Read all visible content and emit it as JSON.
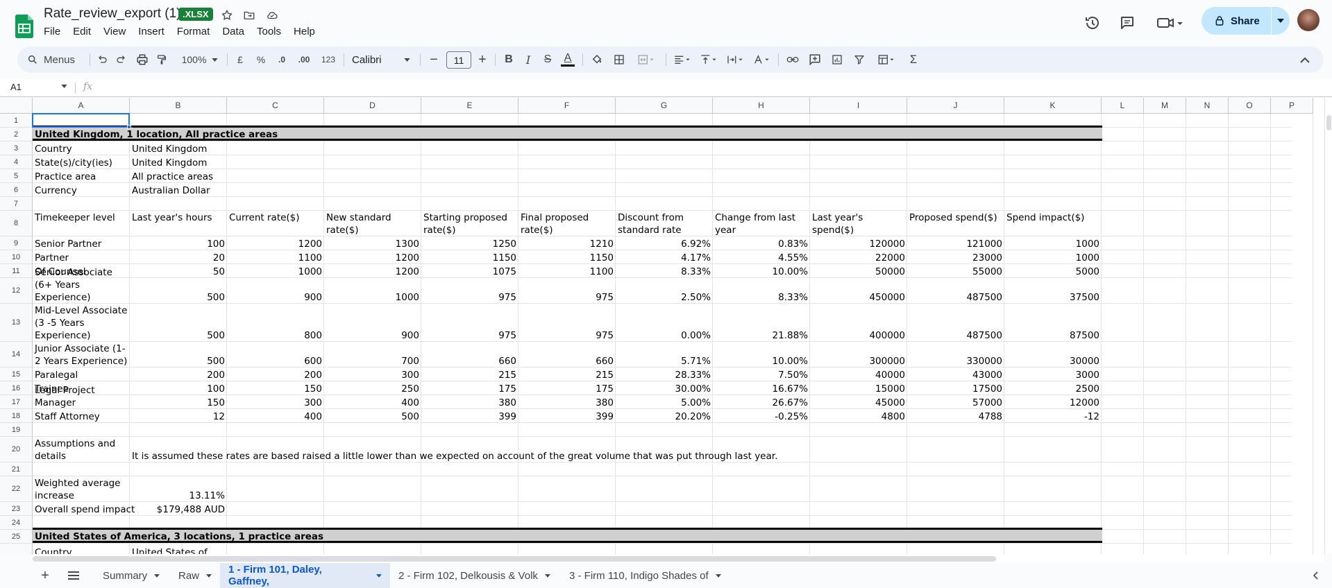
{
  "app": {
    "doc_title": "Rate_review_export (1)",
    "file_badge": ".XLSX",
    "menus": [
      "File",
      "Edit",
      "View",
      "Insert",
      "Format",
      "Data",
      "Tools",
      "Help"
    ],
    "share_label": "Share"
  },
  "toolbar": {
    "search_label": "Menus",
    "zoom": "100%",
    "currency": "£",
    "percent": "%",
    "dec_less": ".0",
    "dec_more": ".00",
    "number_format": "123",
    "font": "Calibri",
    "font_size": "11"
  },
  "formula_bar": {
    "cell_ref": "A1",
    "fx": "fx",
    "content": ""
  },
  "columns": [
    "A",
    "B",
    "C",
    "D",
    "E",
    "F",
    "G",
    "H",
    "I",
    "J",
    "K",
    "L",
    "M",
    "N",
    "O",
    "P"
  ],
  "rows": [
    "1",
    "2",
    "3",
    "4",
    "5",
    "6",
    "7",
    "8",
    "9",
    "10",
    "11",
    "12",
    "13",
    "14",
    "15",
    "16",
    "17",
    "18",
    "19",
    "20",
    "21",
    "22",
    "23",
    "24",
    "25",
    ""
  ],
  "sheet": {
    "section1_title": "United Kingdom, 1 location, All practice areas",
    "info": [
      {
        "label": "Country",
        "value": "United Kingdom"
      },
      {
        "label": "State(s)/city(ies)",
        "value": "United Kingdom"
      },
      {
        "label": "Practice area",
        "value": "All practice areas"
      },
      {
        "label": "Currency",
        "value": "Australian Dollar"
      }
    ],
    "headers": [
      "Timekeeper level",
      "Last year's hours",
      "Current rate($)",
      "New standard rate($)",
      "Starting proposed rate($)",
      "Final proposed rate($)",
      "Discount from standard rate",
      "Change from last year",
      "Last year's spend($)",
      "Proposed spend($)",
      "Spend impact($)"
    ],
    "data_rows": [
      [
        "Senior Partner",
        "100",
        "1200",
        "1300",
        "1250",
        "1210",
        "6.92%",
        "0.83%",
        "120000",
        "121000",
        "1000"
      ],
      [
        "Partner",
        "20",
        "1100",
        "1200",
        "1150",
        "1150",
        "4.17%",
        "4.55%",
        "22000",
        "23000",
        "1000"
      ],
      [
        "Of Counsel",
        "50",
        "1000",
        "1200",
        "1075",
        "1100",
        "8.33%",
        "10.00%",
        "50000",
        "55000",
        "5000"
      ],
      [
        "Senior Associate (6+ Years Experience)",
        "500",
        "900",
        "1000",
        "975",
        "975",
        "2.50%",
        "8.33%",
        "450000",
        "487500",
        "37500"
      ],
      [
        "Mid-Level Associate (3 -5 Years Experience)",
        "500",
        "800",
        "900",
        "975",
        "975",
        "0.00%",
        "21.88%",
        "400000",
        "487500",
        "87500"
      ],
      [
        "Junior Associate (1-2 Years Experience)",
        "500",
        "600",
        "700",
        "660",
        "660",
        "5.71%",
        "10.00%",
        "300000",
        "330000",
        "30000"
      ],
      [
        "Paralegal",
        "200",
        "200",
        "300",
        "215",
        "215",
        "28.33%",
        "7.50%",
        "40000",
        "43000",
        "3000"
      ],
      [
        "Trainee",
        "100",
        "150",
        "250",
        "175",
        "175",
        "30.00%",
        "16.67%",
        "15000",
        "17500",
        "2500"
      ],
      [
        "Legal Project Manager",
        "150",
        "300",
        "400",
        "380",
        "380",
        "5.00%",
        "26.67%",
        "45000",
        "57000",
        "12000"
      ],
      [
        "Staff Attorney",
        "12",
        "400",
        "500",
        "399",
        "399",
        "20.20%",
        "-0.25%",
        "4800",
        "4788",
        "-12"
      ]
    ],
    "assumptions_label": "Assumptions and details",
    "assumptions_text": "It is assumed these rates are based raised a little lower than we expected on account of the great volume that was put through last year.",
    "weighted_label": "Weighted average increase",
    "weighted_value": "13.11%",
    "overall_label": "Overall spend impact",
    "overall_value": "$179,488 AUD",
    "section2_title": "United States of America, 3 locations, 1 practice areas",
    "partial_row": [
      "Country",
      "United States of"
    ]
  },
  "tabs": [
    {
      "label": "Summary"
    },
    {
      "label": "Raw"
    },
    {
      "label": "1 - Firm 101, Daley, Gaffney,"
    },
    {
      "label": "2 - Firm 102, Delkousis & Volk"
    },
    {
      "label": "3 - Firm 110, Indigo Shades of"
    }
  ],
  "colors": {
    "accent": "#0b57d0",
    "share_bg": "#c2e7ff",
    "badge": "#188038",
    "band": "#d0d0d0"
  }
}
